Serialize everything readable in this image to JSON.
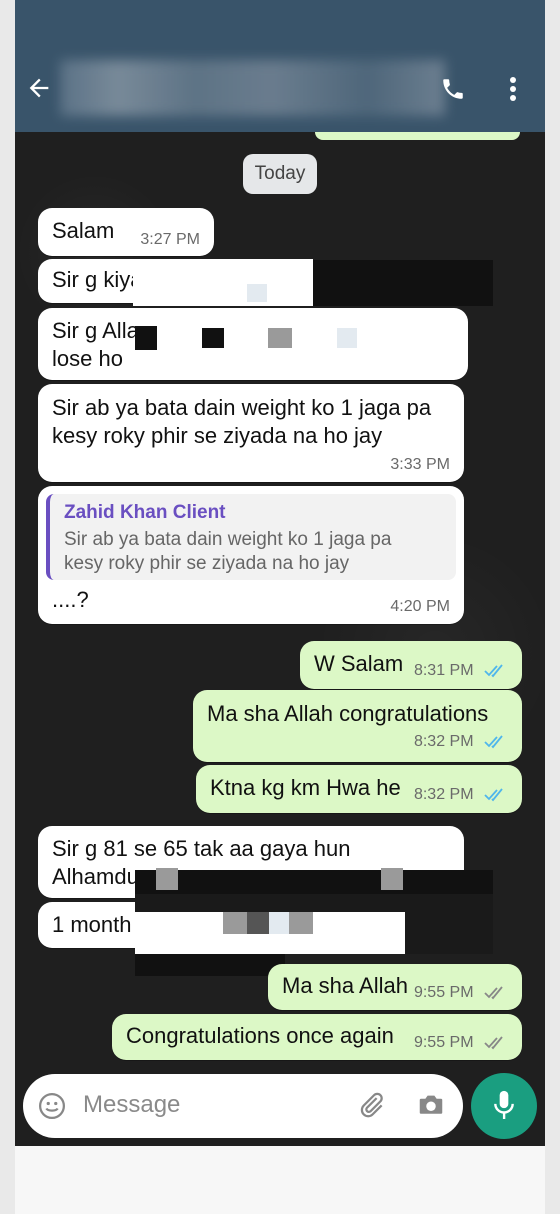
{
  "header": {
    "back_icon": "arrow-left-icon",
    "call_icon": "phone-icon",
    "menu_icon": "more-vert-icon",
    "bg": "#39546a"
  },
  "chat": {
    "date_chip": "Today",
    "messages": [
      {
        "text": "Salam",
        "time": "3:27 PM"
      },
      {
        "text": "Sir g kiya"
      },
      {
        "text": "Sir g Alla\nlose ho"
      },
      {
        "text": "Sir ab ya bata dain weight ko 1 jaga pa\nkesy roky phir se ziyada na ho jay",
        "time": "3:33 PM"
      },
      {
        "quote_author": "Zahid Khan Client",
        "quote_text": "Sir ab ya bata dain weight ko 1 jaga pa\nkesy roky phir se ziyada na ho jay",
        "text": "....?",
        "time": "4:20 PM"
      },
      {
        "text": "W Salam",
        "time": "8:31 PM"
      },
      {
        "text": "Ma sha Allah congratulations",
        "time": "8:32 PM"
      },
      {
        "text": "Ktna kg km Hwa he",
        "time": "8:32 PM"
      },
      {
        "text": "Sir g 81 se 65 tak aa gaya hun\nAlhamdu"
      },
      {
        "text": "1 month"
      },
      {
        "text": "Ma sha Allah",
        "time": "9:55 PM"
      },
      {
        "text": "Congratulations once again",
        "time": "9:55 PM"
      }
    ]
  },
  "composer": {
    "placeholder": "Message",
    "emoji_icon": "emoji-icon",
    "attach_icon": "paperclip-icon",
    "camera_icon": "camera-icon",
    "mic_icon": "mic-icon",
    "mic_bg": "#1a9e80"
  },
  "colors": {
    "incoming": "#ffffff",
    "outgoing": "#dcf8c6",
    "read_ticks": "#4fb6ec",
    "sent_ticks": "#888888"
  }
}
